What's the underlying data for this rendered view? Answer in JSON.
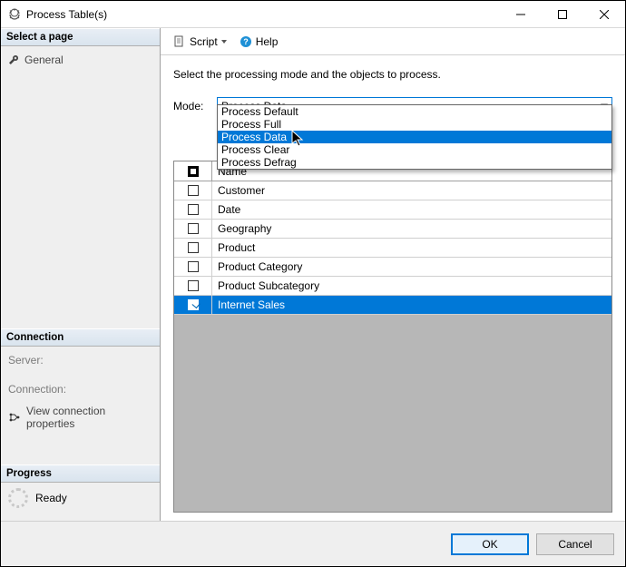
{
  "window": {
    "title": "Process Table(s)"
  },
  "left": {
    "select_page_header": "Select a page",
    "general_item": "General",
    "connection_header": "Connection",
    "server_label": "Server:",
    "connection_label": "Connection:",
    "view_conn_props": "View connection properties",
    "progress_header": "Progress",
    "ready_label": "Ready"
  },
  "toolbar": {
    "script_label": "Script",
    "help_label": "Help"
  },
  "content": {
    "instruction": "Select the processing mode and the objects to process.",
    "mode_label": "Mode:",
    "mode_selected": "Process Data",
    "mode_options": [
      "Process Default",
      "Process Full",
      "Process Data",
      "Process Clear",
      "Process Defrag"
    ],
    "mode_highlight_index": 2,
    "grid_name_header": "Name",
    "rows": [
      {
        "name": "Customer",
        "checked": false,
        "selected": false
      },
      {
        "name": "Date",
        "checked": false,
        "selected": false
      },
      {
        "name": "Geography",
        "checked": false,
        "selected": false
      },
      {
        "name": "Product",
        "checked": false,
        "selected": false
      },
      {
        "name": "Product Category",
        "checked": false,
        "selected": false
      },
      {
        "name": "Product Subcategory",
        "checked": false,
        "selected": false
      },
      {
        "name": "Internet Sales",
        "checked": true,
        "selected": true
      }
    ]
  },
  "footer": {
    "ok": "OK",
    "cancel": "Cancel"
  }
}
